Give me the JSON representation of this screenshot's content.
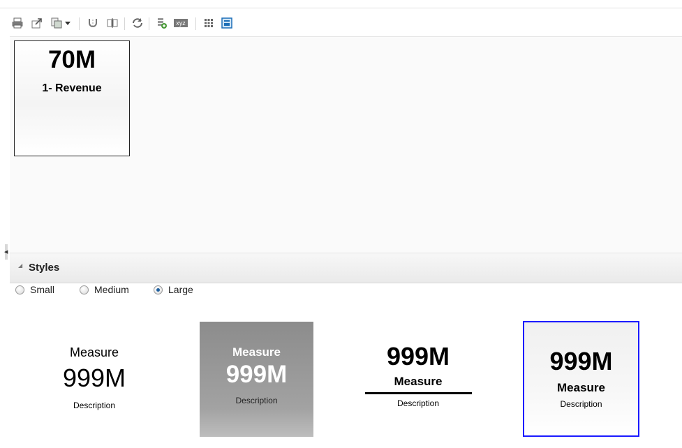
{
  "toolbar": {
    "icons": [
      "print-icon",
      "export-icon",
      "copy-format-icon",
      "dropdown-arrow-icon",
      "magnet-icon",
      "split-icon",
      "refresh-icon",
      "add-data-icon",
      "xyz-icon",
      "grid-icon",
      "tile-view-icon"
    ],
    "xyz_label": "xyz"
  },
  "tile": {
    "value": "70M",
    "label": "1- Revenue"
  },
  "styles": {
    "title": "Styles",
    "sizes": [
      {
        "label": "Small",
        "selected": false
      },
      {
        "label": "Medium",
        "selected": false
      },
      {
        "label": "Large",
        "selected": true
      }
    ],
    "cards": [
      {
        "measure": "Measure",
        "value": "999M",
        "description": "Description"
      },
      {
        "measure": "Measure",
        "value": "999M",
        "description": "Description"
      },
      {
        "measure": "Measure",
        "value": "999M",
        "description": "Description"
      },
      {
        "measure": "Measure",
        "value": "999M",
        "description": "Description"
      }
    ],
    "selected_card_color": "#1a1aff"
  }
}
